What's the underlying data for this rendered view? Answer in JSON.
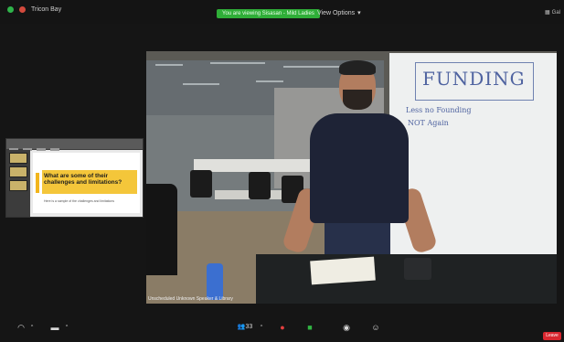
{
  "window": {
    "title_left": "Tricon Bay",
    "recording_pill": "You are viewing Sisasan - Mild Ladies",
    "view_options_label": "View Options",
    "right_label": "Gal"
  },
  "share_thumbnail": {
    "slide_title": "What are some of their challenges and limitations?",
    "slide_subtitle": "Here is a sample of the challenges and limitations"
  },
  "main_video": {
    "whiteboard_title": "FUNDING",
    "whiteboard_line1": "Less no Founding",
    "whiteboard_line2": "NOT Again",
    "speaker_label": "Unscheduled Unknown Speaker & Library"
  },
  "toolbar": {
    "audio_label": "",
    "video_label": "",
    "participants_count": "33",
    "leave_label": "Leave"
  },
  "colors": {
    "recording_green": "#2fae38",
    "leave_red": "#d8272f",
    "background": "#151515"
  }
}
